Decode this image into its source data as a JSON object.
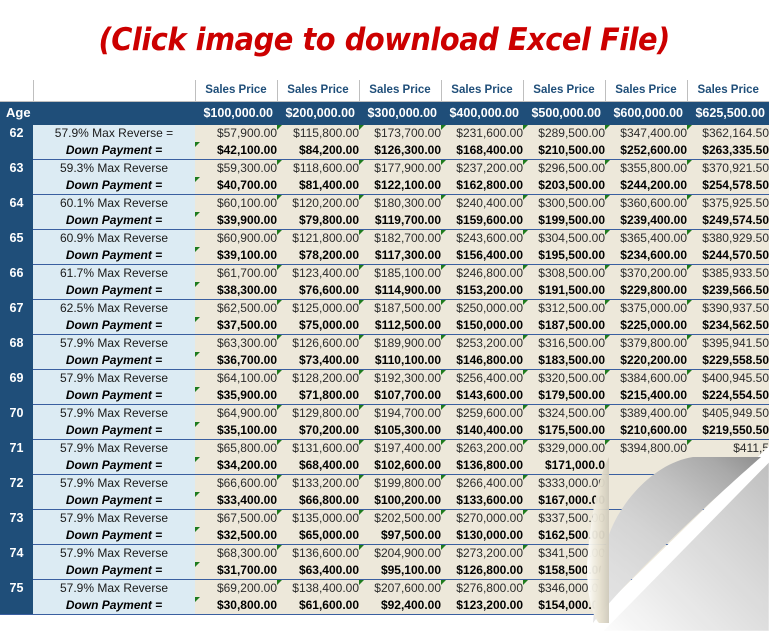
{
  "title": {
    "text": "(Click image to download Excel File)",
    "color": "#CC0000"
  },
  "table": {
    "sales_price_label": "Sales Price",
    "age_header": "Age",
    "down_payment_label": "Down Payment =",
    "columns": [
      "$100,000.00",
      "$200,000.00",
      "$300,000.00",
      "$400,000.00",
      "$500,000.00",
      "$600,000.00",
      "$625,500.00"
    ],
    "rows": [
      {
        "age": "62",
        "reverse_label": "57.9% Max Reverse =",
        "reverse": [
          "$57,900.00",
          "$115,800.00",
          "$173,700.00",
          "$231,600.00",
          "$289,500.00",
          "$347,400.00",
          "$362,164.50"
        ],
        "down": [
          "$42,100.00",
          "$84,200.00",
          "$126,300.00",
          "$168,400.00",
          "$210,500.00",
          "$252,600.00",
          "$263,335.50"
        ]
      },
      {
        "age": "63",
        "reverse_label": "59.3% Max Reverse",
        "reverse": [
          "$59,300.00",
          "$118,600.00",
          "$177,900.00",
          "$237,200.00",
          "$296,500.00",
          "$355,800.00",
          "$370,921.50"
        ],
        "down": [
          "$40,700.00",
          "$81,400.00",
          "$122,100.00",
          "$162,800.00",
          "$203,500.00",
          "$244,200.00",
          "$254,578.50"
        ]
      },
      {
        "age": "64",
        "reverse_label": "60.1% Max Reverse",
        "reverse": [
          "$60,100.00",
          "$120,200.00",
          "$180,300.00",
          "$240,400.00",
          "$300,500.00",
          "$360,600.00",
          "$375,925.50"
        ],
        "down": [
          "$39,900.00",
          "$79,800.00",
          "$119,700.00",
          "$159,600.00",
          "$199,500.00",
          "$239,400.00",
          "$249,574.50"
        ]
      },
      {
        "age": "65",
        "reverse_label": "60.9% Max Reverse",
        "reverse": [
          "$60,900.00",
          "$121,800.00",
          "$182,700.00",
          "$243,600.00",
          "$304,500.00",
          "$365,400.00",
          "$380,929.50"
        ],
        "down": [
          "$39,100.00",
          "$78,200.00",
          "$117,300.00",
          "$156,400.00",
          "$195,500.00",
          "$234,600.00",
          "$244,570.50"
        ]
      },
      {
        "age": "66",
        "reverse_label": "61.7% Max Reverse",
        "reverse": [
          "$61,700.00",
          "$123,400.00",
          "$185,100.00",
          "$246,800.00",
          "$308,500.00",
          "$370,200.00",
          "$385,933.50"
        ],
        "down": [
          "$38,300.00",
          "$76,600.00",
          "$114,900.00",
          "$153,200.00",
          "$191,500.00",
          "$229,800.00",
          "$239,566.50"
        ]
      },
      {
        "age": "67",
        "reverse_label": "62.5% Max Reverse",
        "reverse": [
          "$62,500.00",
          "$125,000.00",
          "$187,500.00",
          "$250,000.00",
          "$312,500.00",
          "$375,000.00",
          "$390,937.50"
        ],
        "down": [
          "$37,500.00",
          "$75,000.00",
          "$112,500.00",
          "$150,000.00",
          "$187,500.00",
          "$225,000.00",
          "$234,562.50"
        ]
      },
      {
        "age": "68",
        "reverse_label": "57.9% Max Reverse",
        "reverse": [
          "$63,300.00",
          "$126,600.00",
          "$189,900.00",
          "$253,200.00",
          "$316,500.00",
          "$379,800.00",
          "$395,941.50"
        ],
        "down": [
          "$36,700.00",
          "$73,400.00",
          "$110,100.00",
          "$146,800.00",
          "$183,500.00",
          "$220,200.00",
          "$229,558.50"
        ]
      },
      {
        "age": "69",
        "reverse_label": "57.9% Max Reverse",
        "reverse": [
          "$64,100.00",
          "$128,200.00",
          "$192,300.00",
          "$256,400.00",
          "$320,500.00",
          "$384,600.00",
          "$400,945.50"
        ],
        "down": [
          "$35,900.00",
          "$71,800.00",
          "$107,700.00",
          "$143,600.00",
          "$179,500.00",
          "$215,400.00",
          "$224,554.50"
        ]
      },
      {
        "age": "70",
        "reverse_label": "57.9% Max Reverse",
        "reverse": [
          "$64,900.00",
          "$129,800.00",
          "$194,700.00",
          "$259,600.00",
          "$324,500.00",
          "$389,400.00",
          "$405,949.50"
        ],
        "down": [
          "$35,100.00",
          "$70,200.00",
          "$105,300.00",
          "$140,400.00",
          "$175,500.00",
          "$210,600.00",
          "$219,550.50"
        ]
      },
      {
        "age": "71",
        "reverse_label": "57.9% Max Reverse",
        "reverse": [
          "$65,800.00",
          "$131,600.00",
          "$197,400.00",
          "$263,200.00",
          "$329,000.00",
          "$394,800.00",
          "$411,5"
        ],
        "down": [
          "$34,200.00",
          "$68,400.00",
          "$102,600.00",
          "$136,800.00",
          "$171,000.0",
          "",
          ""
        ]
      },
      {
        "age": "72",
        "reverse_label": "57.9% Max Reverse",
        "reverse": [
          "$66,600.00",
          "$133,200.00",
          "$199,800.00",
          "$266,400.00",
          "$333,000.00",
          "",
          ""
        ],
        "down": [
          "$33,400.00",
          "$66,800.00",
          "$100,200.00",
          "$133,600.00",
          "$167,000.00",
          "",
          ""
        ]
      },
      {
        "age": "73",
        "reverse_label": "57.9% Max Reverse",
        "reverse": [
          "$67,500.00",
          "$135,000.00",
          "$202,500.00",
          "$270,000.00",
          "$337,500.00",
          "",
          ""
        ],
        "down": [
          "$32,500.00",
          "$65,000.00",
          "$97,500.00",
          "$130,000.00",
          "$162,500.00",
          "",
          ""
        ]
      },
      {
        "age": "74",
        "reverse_label": "57.9% Max Reverse",
        "reverse": [
          "$68,300.00",
          "$136,600.00",
          "$204,900.00",
          "$273,200.00",
          "$341,500.00",
          "",
          ""
        ],
        "down": [
          "$31,700.00",
          "$63,400.00",
          "$95,100.00",
          "$126,800.00",
          "$158,500.00",
          "",
          ""
        ]
      },
      {
        "age": "75",
        "reverse_label": "57.9% Max Reverse",
        "reverse": [
          "$69,200.00",
          "$138,400.00",
          "$207,600.00",
          "$276,800.00",
          "$346,000.00",
          "",
          ""
        ],
        "down": [
          "$30,800.00",
          "$61,600.00",
          "$92,400.00",
          "$123,200.00",
          "$154,000.00",
          "",
          ""
        ]
      }
    ]
  },
  "colors": {
    "header_blue": "#1F4E79",
    "label_blue": "#DCEBF3",
    "data_beige": "#EDE8DA",
    "title_red": "#CC0000",
    "marker_green": "#1E7B1E"
  }
}
